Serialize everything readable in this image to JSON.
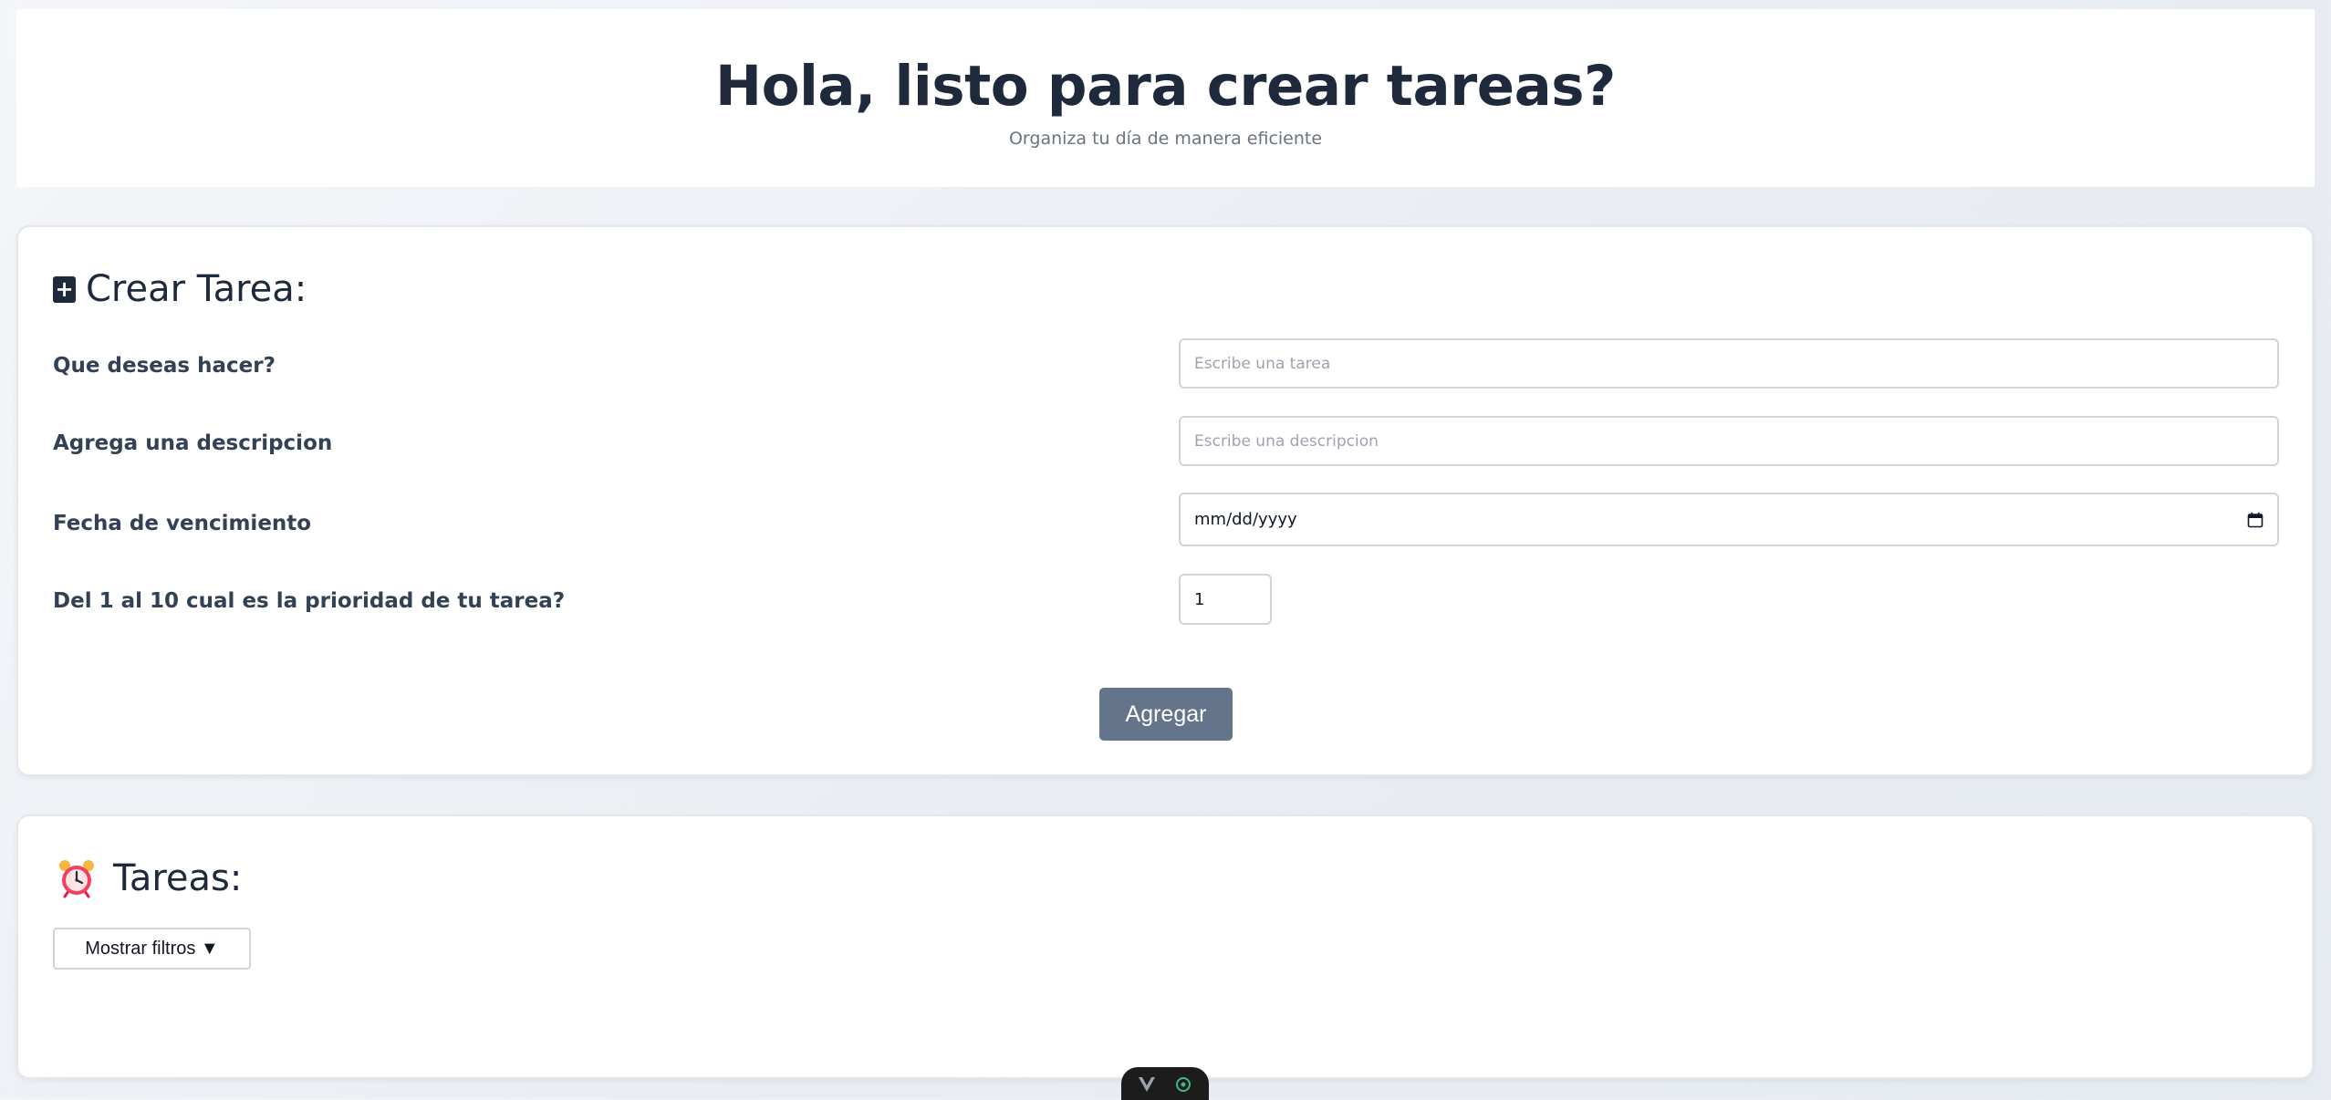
{
  "header": {
    "title": "Hola, listo para crear tareas?",
    "subtitle": "Organiza tu día de manera eficiente"
  },
  "create_section": {
    "icon": "plus-square-icon",
    "title": "Crear Tarea:",
    "fields": {
      "task": {
        "label": "Que deseas hacer?",
        "placeholder": "Escribe una tarea",
        "value": ""
      },
      "description": {
        "label": "Agrega una descripcion",
        "placeholder": "Escribe una descripcion",
        "value": ""
      },
      "due_date": {
        "label": "Fecha de vencimiento",
        "value_display": "mm/dd/yyyy",
        "icon": "calendar-icon"
      },
      "priority": {
        "label": "Del 1 al 10 cual es la prioridad de tu tarea?",
        "value": "1"
      }
    },
    "submit_label": "Agregar",
    "submit_color": "#64748b"
  },
  "tasks_section": {
    "icon": "alarm-clock-icon",
    "title": "Tareas:",
    "filter_button_label": "Mostrar filtros ▼"
  },
  "dev_toolbar": {
    "icons": [
      "vue-logo-icon",
      "target-icon"
    ],
    "accent": "#42b883"
  },
  "colors": {
    "heading": "#1e293b",
    "subtitle": "#6b7280",
    "input_border": "#d1d5db"
  }
}
